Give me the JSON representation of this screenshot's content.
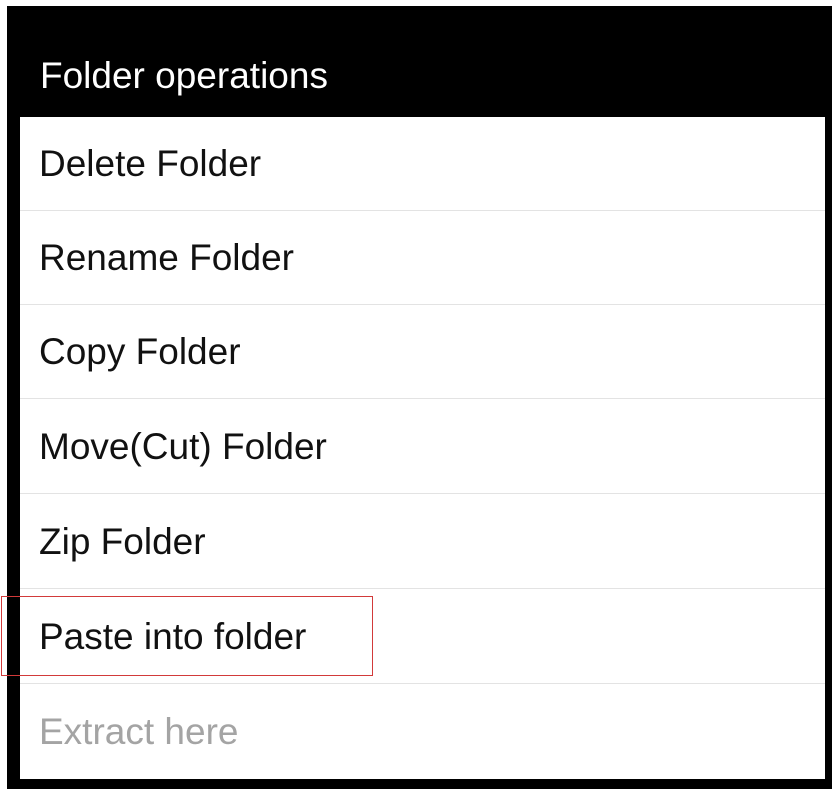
{
  "dialog": {
    "title": "Folder operations",
    "items": [
      {
        "label": "Delete Folder",
        "enabled": true
      },
      {
        "label": "Rename Folder",
        "enabled": true
      },
      {
        "label": "Copy Folder",
        "enabled": true
      },
      {
        "label": "Move(Cut) Folder",
        "enabled": true
      },
      {
        "label": "Zip Folder",
        "enabled": true
      },
      {
        "label": "Paste into folder",
        "enabled": true,
        "highlighted": true
      },
      {
        "label": "Extract here",
        "enabled": false
      }
    ]
  },
  "colors": {
    "title_background": "#000000",
    "title_text": "#ffffff",
    "item_text": "#111111",
    "disabled_text": "#a4a4a4",
    "highlight_border": "#d23a3a"
  }
}
